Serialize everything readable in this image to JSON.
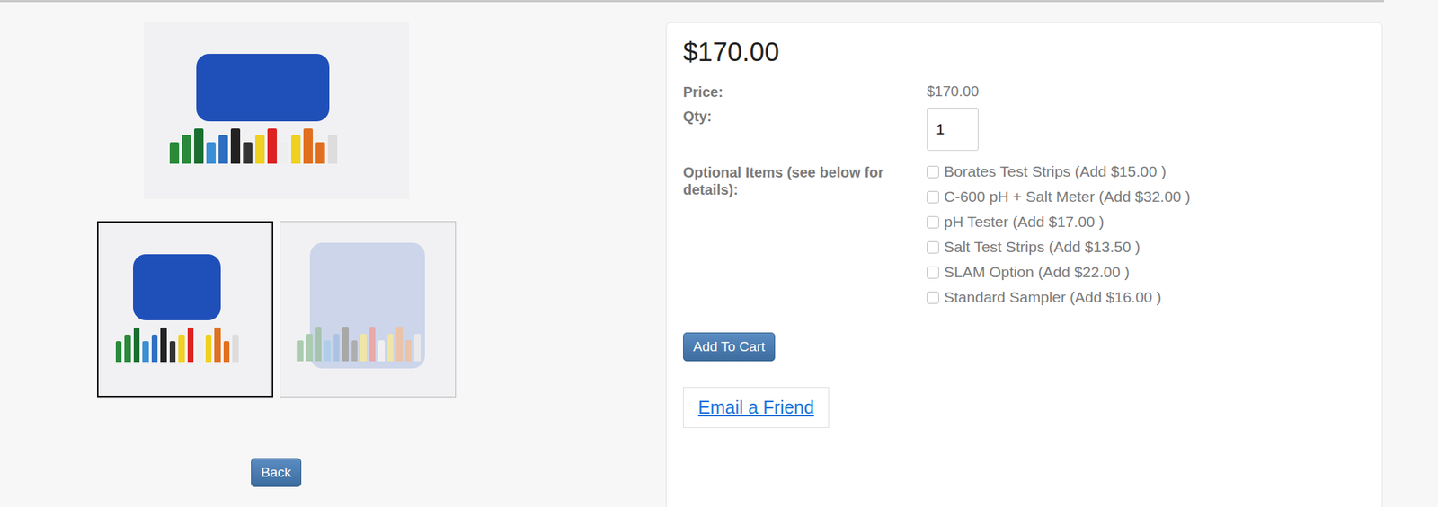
{
  "price_heading": "$170.00",
  "price": {
    "label": "Price:",
    "value": "$170.00"
  },
  "qty": {
    "label": "Qty:",
    "value": "1"
  },
  "optional": {
    "label": "Optional Items (see below for details):",
    "items": [
      {
        "label": "Borates Test Strips (Add $15.00 )",
        "checked": false
      },
      {
        "label": "C-600 pH + Salt Meter (Add $32.00 )",
        "checked": false
      },
      {
        "label": "pH Tester (Add $17.00 )",
        "checked": false
      },
      {
        "label": "Salt Test Strips (Add $13.50 )",
        "checked": false
      },
      {
        "label": "SLAM Option (Add $22.00 )",
        "checked": false
      },
      {
        "label": "Standard Sampler (Add $16.00 )",
        "checked": false
      }
    ]
  },
  "add_to_cart": "Add To Cart",
  "email_friend": "Email a Friend",
  "back": "Back",
  "thumbnails": [
    {
      "selected": true
    },
    {
      "selected": false
    }
  ]
}
